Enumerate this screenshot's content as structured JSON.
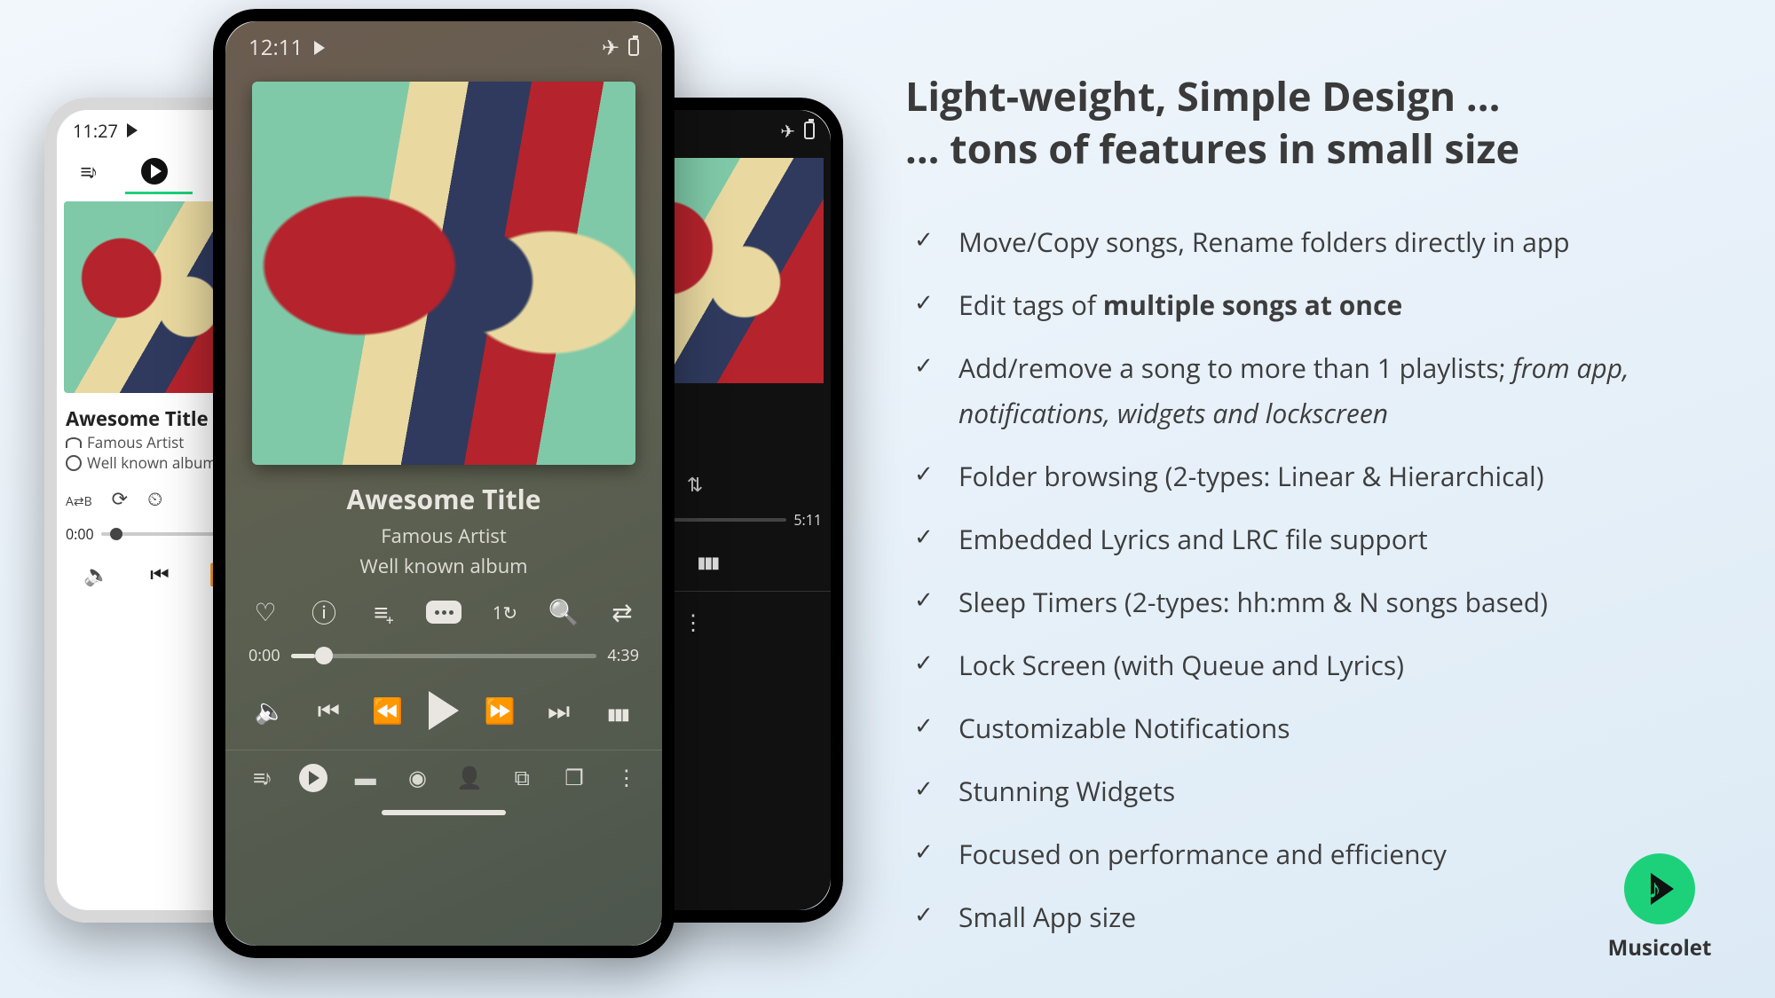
{
  "headline_line1": "Light-weight, Simple Design ...",
  "headline_line2": "... tons of features in small size",
  "features": [
    {
      "html": "Move/Copy songs, Rename folders directly in app"
    },
    {
      "html": "Edit tags of <span class=\"strong\">multiple songs at once</span>"
    },
    {
      "html": "Add/remove a song to more than 1 playlists; <span class=\"italic\">from app, notifications, widgets and lockscreen</span>"
    },
    {
      "html": "Folder browsing (2-types: Linear & Hierarchical)"
    },
    {
      "html": "Embedded Lyrics and LRC file support"
    },
    {
      "html": "Sleep Timers (2-types: hh:mm & N songs based)"
    },
    {
      "html": "Lock Screen (with Queue and Lyrics)"
    },
    {
      "html": "Customizable Notifications"
    },
    {
      "html": "Stunning Widgets"
    },
    {
      "html": "Focused on performance and efficiency"
    },
    {
      "html": "Small App size"
    }
  ],
  "brand_name": "Musicolet",
  "player": {
    "title": "Awesome Title",
    "artist": "Famous Artist",
    "album": "Well known album",
    "elapsed": "0:00",
    "total_center": "4:39",
    "total_right": "5:11"
  },
  "status": {
    "left_time": "11:27",
    "center_time": "12:11"
  }
}
